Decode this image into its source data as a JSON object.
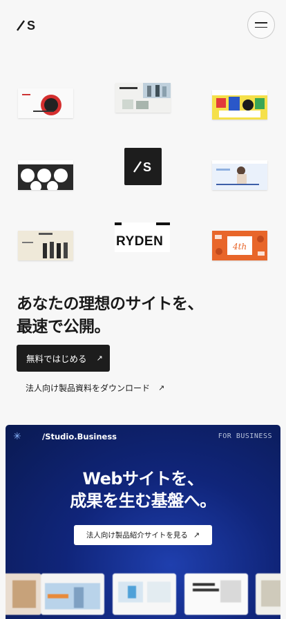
{
  "header": {
    "logo_icon": "studio-logo-icon",
    "menu_icon": "hamburger-icon"
  },
  "showcase": {
    "center_logo": "studio-logo-icon",
    "ryden_word": "RYDEN"
  },
  "hero": {
    "headline_line1": "あなたの理想のサイトを、",
    "headline_line2": "最速で公開。",
    "primary_cta": "無料ではじめる",
    "secondary_cta": "法人向け製品資料をダウンロード",
    "arrow": "↗"
  },
  "business": {
    "asterisk": "✳",
    "brand": "/Studio.Business",
    "tag": "FOR BUSINESS",
    "headline_line1": "Webサイトを、",
    "headline_line2": "成果を生む基盤へ。",
    "cta": "法人向け製品紹介サイトを見る",
    "arrow": "↗"
  },
  "colors": {
    "accent_dark": "#1d1d1d",
    "business_bg": "#10257a",
    "page_bg": "#f7f7f7"
  }
}
